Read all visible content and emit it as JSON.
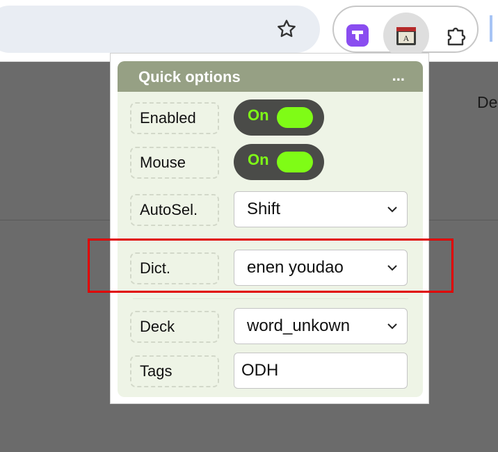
{
  "toolbar": {
    "icons": [
      "star-icon",
      "extension-purple-icon",
      "dictionary-extension-icon",
      "puzzle-extensions-icon"
    ]
  },
  "page": {
    "partial_text": "De"
  },
  "popup": {
    "title": "Quick options",
    "more_label": "...",
    "rows": {
      "enabled": {
        "label": "Enabled",
        "toggle_text": "On"
      },
      "mouse": {
        "label": "Mouse",
        "toggle_text": "On"
      },
      "autosel": {
        "label": "AutoSel.",
        "value": "Shift"
      },
      "dict": {
        "label": "Dict.",
        "value": "enen youdao"
      },
      "deck": {
        "label": "Deck",
        "value": "word_unkown"
      },
      "tags": {
        "label": "Tags",
        "value": "ODH"
      }
    }
  },
  "colors": {
    "header_bg": "#96a084",
    "panel_bg": "#eef4e6",
    "toggle_bg": "#4a4b48",
    "toggle_accent": "#7ffc16",
    "highlight": "#e00000"
  }
}
